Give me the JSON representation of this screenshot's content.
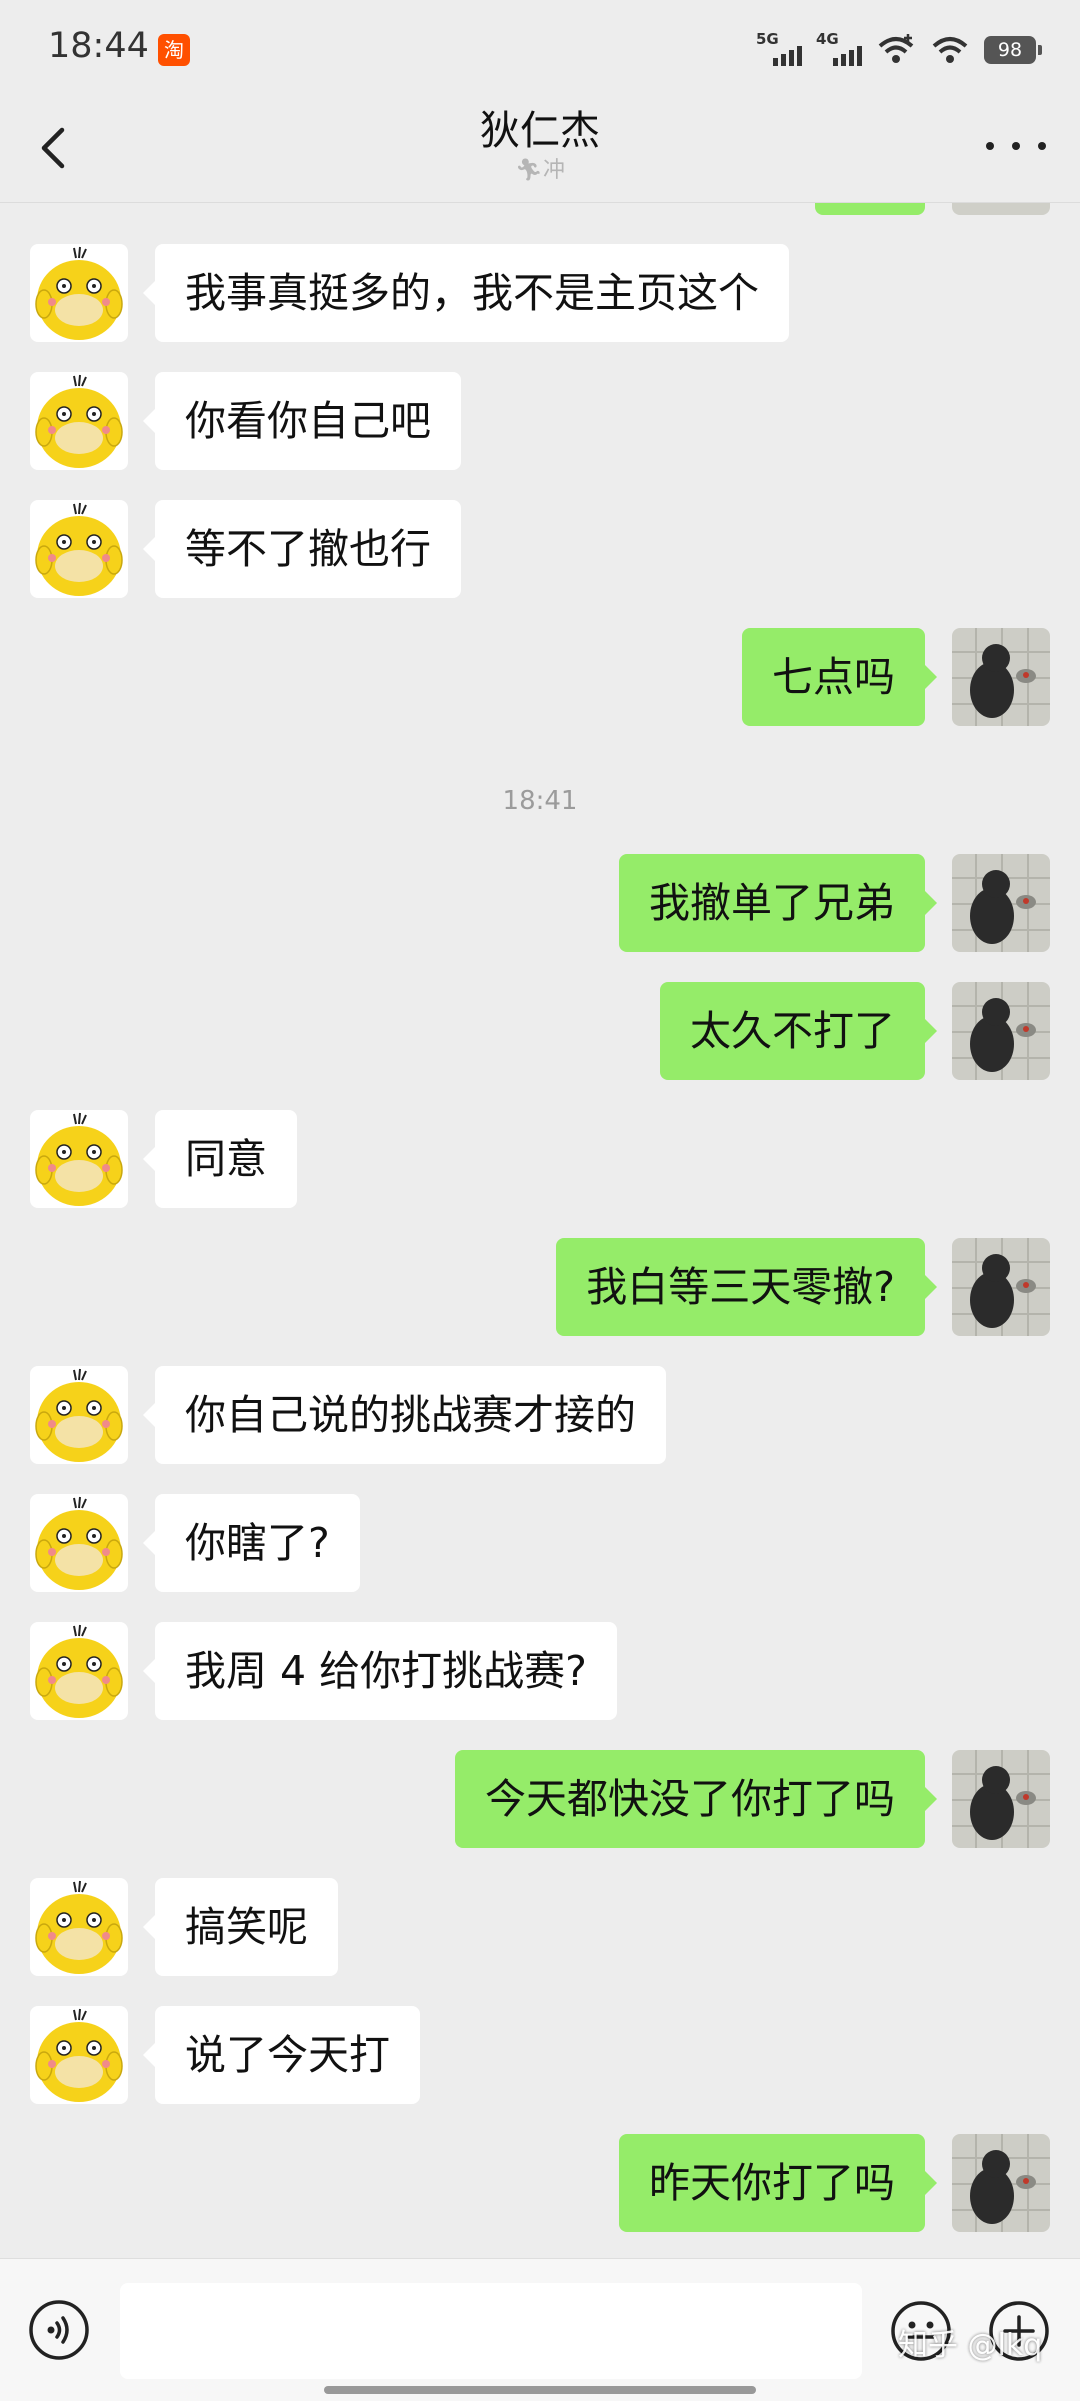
{
  "status_bar": {
    "time": "18:44",
    "app_icon": "taobao-icon",
    "app_icon_text": "淘",
    "network_1": "5G",
    "network_2": "4G",
    "battery": "98"
  },
  "header": {
    "title": "狄仁杰",
    "subtitle": "冲"
  },
  "colors": {
    "background": "#ededed",
    "incoming_bubble": "#ffffff",
    "outgoing_bubble": "#95ec69"
  },
  "messages": [
    {
      "dir": "in",
      "text": "我事真挺多的，我不是主页这个"
    },
    {
      "dir": "in",
      "text": "你看你自己吧"
    },
    {
      "dir": "in",
      "text": "等不了撤也行"
    },
    {
      "dir": "out",
      "text": "七点吗"
    },
    {
      "type": "time",
      "text": "18:41"
    },
    {
      "dir": "out",
      "text": "我撤单了兄弟"
    },
    {
      "dir": "out",
      "text": "太久不打了"
    },
    {
      "dir": "in",
      "text": "同意"
    },
    {
      "dir": "out",
      "text": "我白等三天零撤?"
    },
    {
      "dir": "in",
      "text": "你自己说的挑战赛才接的"
    },
    {
      "dir": "in",
      "text": "你瞎了?"
    },
    {
      "dir": "in",
      "text": "我周 4 给你打挑战赛?"
    },
    {
      "dir": "out",
      "text": "今天都快没了你打了吗"
    },
    {
      "dir": "in",
      "text": "搞笑呢"
    },
    {
      "dir": "in",
      "text": "说了今天打"
    },
    {
      "dir": "out",
      "text": "昨天你打了吗"
    }
  ],
  "input": {
    "value": "",
    "placeholder": ""
  },
  "watermark": "知乎 @lkq"
}
